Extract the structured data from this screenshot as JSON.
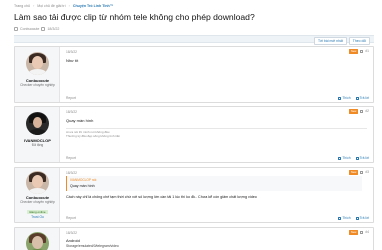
{
  "breadcrumb": [
    "Trang chủ",
    "Mọi chủ đề giải trí",
    "Chuyện Trò Linh Tinh™"
  ],
  "thread": {
    "title": "Làm sao tải được clip từ nhóm tele không cho phép download?",
    "author": "Conbuocute",
    "date": "18/3/22"
  },
  "actions": {
    "unread": "Tới bài mới nhất",
    "watch": "Theo dõi"
  },
  "posts": [
    {
      "user": "Conbuocute",
      "role": "Checker chuyên nghiệp",
      "date": "18/3/22",
      "badge": "New",
      "number": "#1",
      "text": "Như tít"
    },
    {
      "user": "IVANMOCLOP",
      "role": "Đã tặng",
      "date": "18/3/22",
      "badge": "New",
      "number": "#2",
      "text": "Quay màn hình",
      "sig1": "Ai ưa nói thì mình nói không đâu",
      "sig2": "Thường ký đầu đẹp sống không tình tiền"
    },
    {
      "user": "Conbuocute",
      "role": "Checker chuyên nghiệp",
      "badge_green": "Đang online",
      "tag2": "Trust Ou",
      "date": "18/3/22",
      "badge": "New",
      "number": "#3",
      "quote_head": "IVANMOCLOP nói:",
      "quote_text": "Quay màn hình",
      "text": "Cách này chỉ là chống chế tạm thời chứ với số lượng lớn cần tải 1 lúc thì ko đk.. Chưa kể còn giảm chất lượng video"
    },
    {
      "user": "",
      "role": "",
      "date": "18/3/22",
      "badge": "New",
      "number": "#4",
      "text": "Android",
      "text2": "Storage/emulated/0/telegram/video"
    }
  ],
  "footer": {
    "report": "Report",
    "like": "Thích",
    "reply": "Trả lời"
  }
}
